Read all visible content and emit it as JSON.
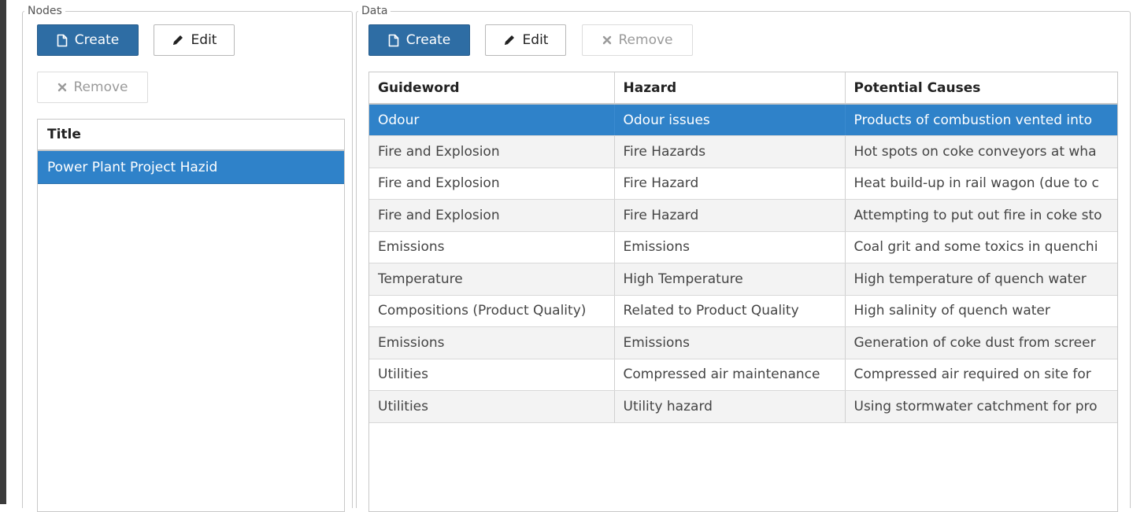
{
  "nodes": {
    "legend": "Nodes",
    "create_label": "Create",
    "edit_label": "Edit",
    "remove_label": "Remove",
    "list_header": "Title",
    "items": [
      "Power Plant Project Hazid"
    ]
  },
  "data": {
    "legend": "Data",
    "create_label": "Create",
    "edit_label": "Edit",
    "remove_label": "Remove",
    "columns": [
      "Guideword",
      "Hazard",
      "Potential Causes"
    ],
    "rows": [
      [
        "Odour",
        "Odour issues",
        "Products of combustion vented into"
      ],
      [
        "Fire and Explosion",
        "Fire Hazards",
        "Hot spots on coke conveyors at wha"
      ],
      [
        "Fire and Explosion",
        "Fire Hazard",
        "Heat build-up in rail wagon (due to c"
      ],
      [
        "Fire and Explosion",
        "Fire Hazard",
        "Attempting to put out fire in coke sto"
      ],
      [
        "Emissions",
        "Emissions",
        "Coal grit and some toxics in quenchi"
      ],
      [
        "Temperature",
        "High Temperature",
        "High temperature of quench water"
      ],
      [
        "Compositions (Product Quality)",
        "Related to Product Quality",
        "High salinity of quench water"
      ],
      [
        "Emissions",
        "Emissions",
        "Generation of coke dust from screer"
      ],
      [
        "Utilities",
        "Compressed air maintenance",
        "Compressed air required on site for"
      ],
      [
        "Utilities",
        "Utility hazard",
        "Using stormwater catchment for pro"
      ]
    ]
  },
  "colors": {
    "primary": "#2e6da4",
    "selection": "#2f82c9"
  }
}
